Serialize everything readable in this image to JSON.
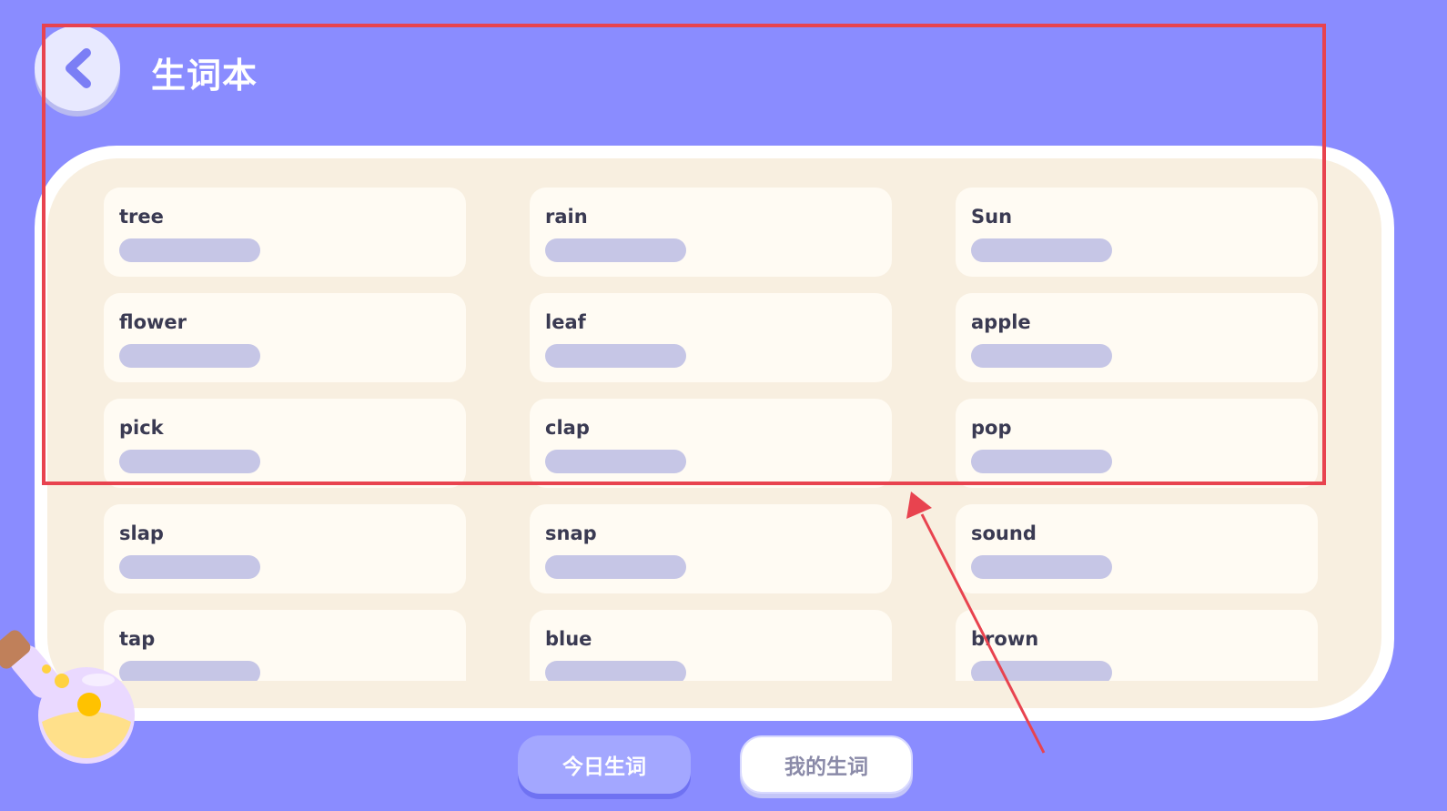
{
  "header": {
    "title": "生词本"
  },
  "words": [
    {
      "word": "tree"
    },
    {
      "word": "rain"
    },
    {
      "word": "Sun"
    },
    {
      "word": "flower"
    },
    {
      "word": "leaf"
    },
    {
      "word": "apple"
    },
    {
      "word": "pick"
    },
    {
      "word": "clap"
    },
    {
      "word": "pop"
    },
    {
      "word": "slap"
    },
    {
      "word": "snap"
    },
    {
      "word": "sound"
    },
    {
      "word": "tap"
    },
    {
      "word": "blue"
    },
    {
      "word": "brown"
    }
  ],
  "tabs": [
    {
      "label": "今日生词",
      "active": true
    },
    {
      "label": "我的生词",
      "active": false
    }
  ],
  "colors": {
    "background": "#8a8cff",
    "card": "#fffbf3",
    "board": "#f8efe0",
    "placeholder_bar": "#c6c6e6",
    "annotation": "#e8434f"
  }
}
